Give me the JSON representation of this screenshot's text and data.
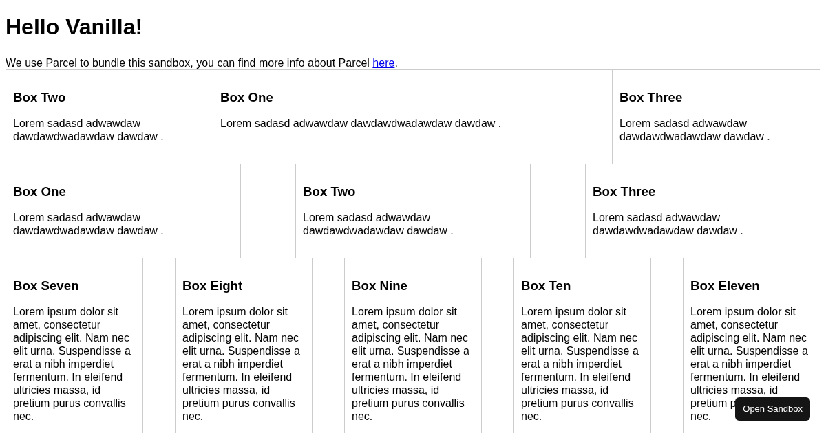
{
  "title": "Hello Vanilla!",
  "intro": {
    "text": "We use Parcel to bundle this sandbox, you can find more info about Parcel ",
    "link": "here",
    "after": "."
  },
  "rows": [
    {
      "kind": "wide",
      "boxes": [
        {
          "title": "Box Two",
          "body": "Lorem sadasd adwawdaw dawdawdwadawdaw dawdaw ."
        },
        {
          "title": "Box One",
          "body": "Lorem sadasd adwawdaw dawdawdwadawdaw dawdaw ."
        },
        {
          "title": "Box Three",
          "body": "Lorem sadasd adwawdaw dawdawdwadawdaw dawdaw ."
        }
      ]
    },
    {
      "kind": "spaced",
      "boxes": [
        {
          "title": "Box One",
          "body": "Lorem sadasd adwawdaw dawdawdwadawdaw dawdaw ."
        },
        {
          "title": "Box Two",
          "body": "Lorem sadasd adwawdaw dawdawdwadawdaw dawdaw ."
        },
        {
          "title": "Box Three",
          "body": "Lorem sadasd adwawdaw dawdawdwadawdaw dawdaw ."
        }
      ]
    },
    {
      "kind": "five",
      "boxes": [
        {
          "title": "Box Seven",
          "body": "Lorem ipsum dolor sit amet, consectetur adipiscing elit. Nam nec elit urna. Suspendisse a erat a nibh imperdiet fermentum. In eleifend ultricies massa, id pretium purus convallis nec."
        },
        {
          "title": "Box Eight",
          "body": "Lorem ipsum dolor sit amet, consectetur adipiscing elit. Nam nec elit urna. Suspendisse a erat a nibh imperdiet fermentum. In eleifend ultricies massa, id pretium purus convallis nec."
        },
        {
          "title": "Box Nine",
          "body": "Lorem ipsum dolor sit amet, consectetur adipiscing elit. Nam nec elit urna. Suspendisse a erat a nibh imperdiet fermentum. In eleifend ultricies massa, id pretium purus convallis nec."
        },
        {
          "title": "Box Ten",
          "body": "Lorem ipsum dolor sit amet, consectetur adipiscing elit. Nam nec elit urna. Suspendisse a erat a nibh imperdiet fermentum. In eleifend ultricies massa, id pretium purus convallis nec."
        },
        {
          "title": "Box Eleven",
          "body": [
            "Lorem ipsum dolor sit amet, consectetur adipiscing elit. Nam nec elit urna. Suspendisse a erat a nibh imperdiet fermentum. In eleifend ultricies massa, id",
            "pretium p",
            "nec."
          ]
        }
      ]
    }
  ],
  "sandbox_button": "Open Sandbox"
}
